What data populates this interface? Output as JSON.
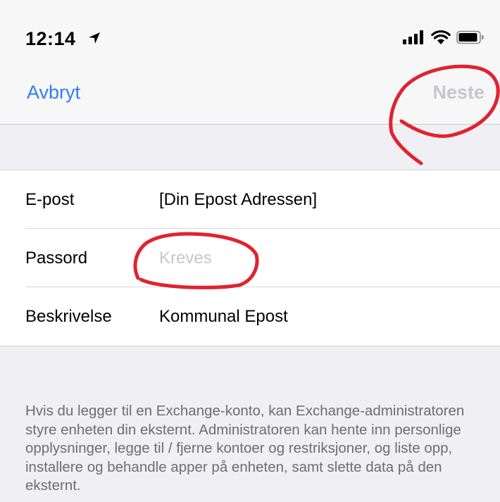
{
  "status_bar": {
    "time": "12:14",
    "location_icon": "location-arrow-icon",
    "signal_icon": "cellular-signal-icon",
    "wifi_icon": "wifi-icon",
    "battery_icon": "battery-icon"
  },
  "nav": {
    "cancel_label": "Avbryt",
    "next_label": "Neste"
  },
  "form": {
    "rows": [
      {
        "label": "E-post",
        "value": "[Din Epost Adressen]",
        "placeholder": ""
      },
      {
        "label": "Passord",
        "value": "",
        "placeholder": "Kreves"
      },
      {
        "label": "Beskrivelse",
        "value": "Kommunal Epost",
        "placeholder": ""
      }
    ]
  },
  "footer": {
    "text": "Hvis du legger til en Exchange-konto, kan Exchange-administratoren styre enheten din eksternt. Administratoren kan hente inn personlige opplysninger, legge til / fjerne kontoer og restriksjoner, og liste opp, installere og behandle apper på enheten, samt slette data på den eksternt."
  },
  "colors": {
    "accent": "#2f7cf6",
    "disabled": "#c7c7cc",
    "annotation": "#e0232f",
    "background": "#efeff4"
  }
}
